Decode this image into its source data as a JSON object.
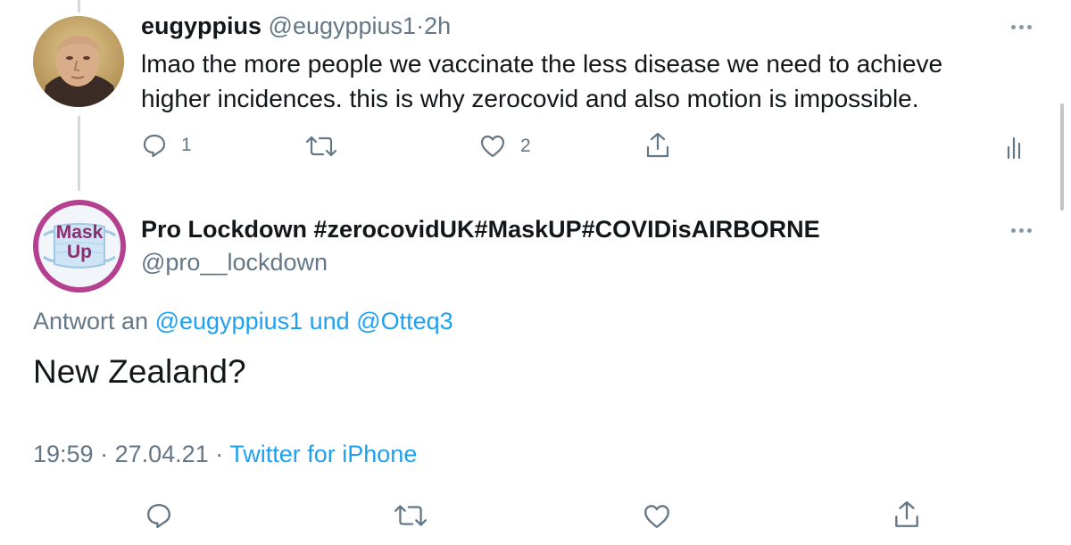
{
  "first_tweet": {
    "name": "eugyppius",
    "handle": "@eugyppius1",
    "separator": "·",
    "time": "2h",
    "text_line1": "lmao the more people we vaccinate the less disease we need to achieve",
    "text_line2": "higher incidences. this is why zerocovid and also motion is impossible.",
    "reply_count": "1",
    "like_count": "2"
  },
  "main_tweet": {
    "name": "Pro Lockdown #zerocovidUK#MaskUP#COVIDisAIRBORNE",
    "handle": "@pro__lockdown",
    "avatar_line1": "Mask",
    "avatar_line2": "Up",
    "reply_prefix": "Antwort an",
    "reply_user1": "@eugyppius1",
    "reply_and": "und",
    "reply_user2": "@Otteq3",
    "text": "New Zealand?",
    "time": "19:59",
    "dot1": "·",
    "date": "27.04.21",
    "dot2": "·",
    "source": "Twitter for iPhone"
  },
  "colors": {
    "accent": "#1da1f2",
    "secondary_text": "#657786",
    "avatar_ring": "#b5408f"
  },
  "icons": [
    "reply-icon",
    "retweet-icon",
    "like-icon",
    "share-icon",
    "analytics-icon",
    "more-icon"
  ]
}
